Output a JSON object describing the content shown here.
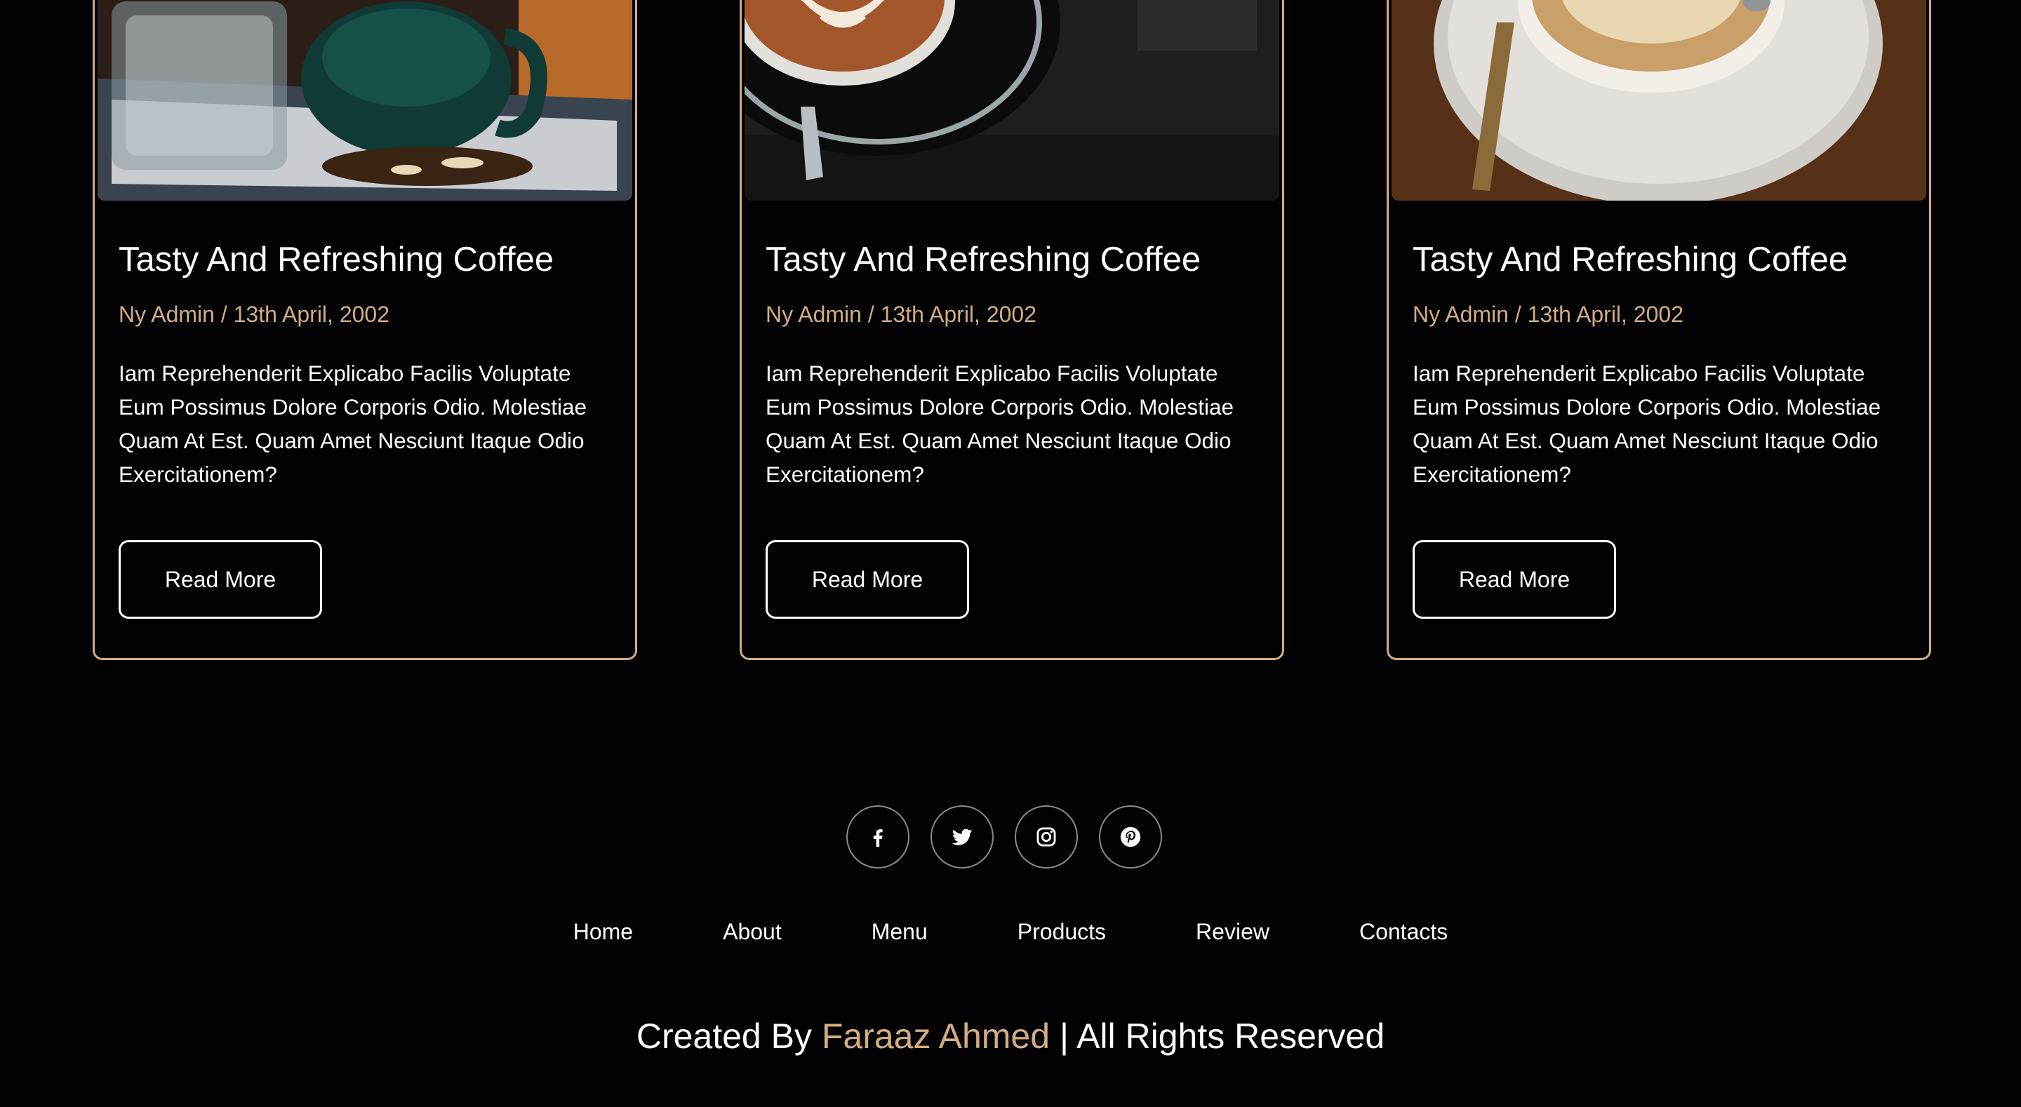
{
  "blog": {
    "cards": [
      {
        "title": "Tasty And Refreshing Coffee",
        "meta": "Ny Admin / 13th April, 2002",
        "text": "Iam Reprehenderit Explicabo Facilis Voluptate Eum Possimus Dolore Corporis Odio. Molestiae Quam At Est. Quam Amet Nesciunt Itaque Odio Exercitationem?",
        "button": "Read More",
        "image": "coffee-tray-photo"
      },
      {
        "title": "Tasty And Refreshing Coffee",
        "meta": "Ny Admin / 13th April, 2002",
        "text": "Iam Reprehenderit Explicabo Facilis Voluptate Eum Possimus Dolore Corporis Odio. Molestiae Quam At Est. Quam Amet Nesciunt Itaque Odio Exercitationem?",
        "button": "Read More",
        "image": "latte-art-photo"
      },
      {
        "title": "Tasty And Refreshing Coffee",
        "meta": "Ny Admin / 13th April, 2002",
        "text": "Iam Reprehenderit Explicabo Facilis Voluptate Eum Possimus Dolore Corporis Odio. Molestiae Quam At Est. Quam Amet Nesciunt Itaque Odio Exercitationem?",
        "button": "Read More",
        "image": "cappuccino-saucer-photo"
      }
    ]
  },
  "footer": {
    "social": [
      {
        "icon": "facebook-icon"
      },
      {
        "icon": "twitter-icon"
      },
      {
        "icon": "instagram-icon"
      },
      {
        "icon": "pinterest-icon"
      }
    ],
    "nav": [
      "Home",
      "About",
      "Menu",
      "Products",
      "Review",
      "Contacts"
    ],
    "credit_prefix": "Created By",
    "credit_author": "Faraaz Ahmed",
    "credit_suffix": "| All Rights Reserved"
  },
  "colors": {
    "background": "#010103",
    "accent": "#d3ad7f",
    "text": "#ffffff"
  }
}
